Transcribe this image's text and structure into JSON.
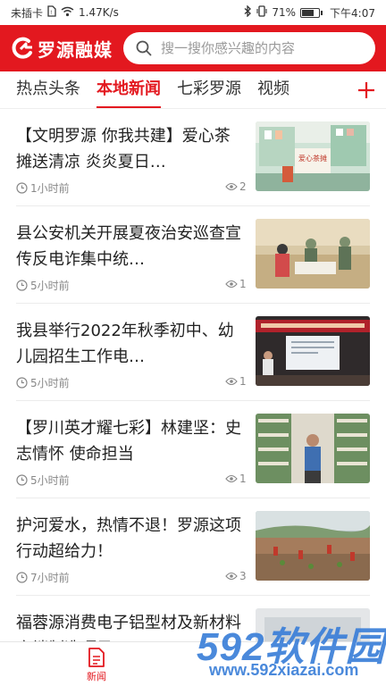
{
  "status_bar": {
    "sim_status": "未插卡",
    "speed": "1.47K/s",
    "battery_level": "71%",
    "battery_fraction": 0.71,
    "time": "下午4:07"
  },
  "header": {
    "logo_text": "罗源融媒",
    "search_placeholder": "搜一搜你感兴趣的内容",
    "brand_color": "#e3181f"
  },
  "tabs": [
    {
      "label": "热点头条",
      "active": false
    },
    {
      "label": "本地新闻",
      "active": true
    },
    {
      "label": "七彩罗源",
      "active": false
    },
    {
      "label": "视频",
      "active": false
    }
  ],
  "add_tab_icon": "plus-icon",
  "news": [
    {
      "title": "【文明罗源 你我共建】爱心茶摊送清凉 炎炎夏日…",
      "time": "1小时前",
      "views": "2",
      "thumb": "pharmacy-counter-photo"
    },
    {
      "title": "县公安机关开展夏夜治安巡查宣传反电诈集中统…",
      "time": "5小时前",
      "views": "1",
      "thumb": "police-patrol-photo"
    },
    {
      "title": "我县举行2022年秋季初中、幼儿园招生工作电…",
      "time": "5小时前",
      "views": "1",
      "thumb": "meeting-room-photo"
    },
    {
      "title": "【罗川英才耀七彩】林建坚：史志情怀 使命担当",
      "time": "5小时前",
      "views": "1",
      "thumb": "archive-shelves-photo"
    },
    {
      "title": "护河爱水，热情不退！罗源这项行动超给力！",
      "time": "7小时前",
      "views": "3",
      "thumb": "riverbank-volunteers-photo"
    },
    {
      "title": "福蓉源消费电子铝型材及新材料高端制造项目…",
      "time": "",
      "views": "",
      "thumb": "building-photo"
    }
  ],
  "bottom_nav": {
    "items": [
      {
        "label": "新闻",
        "icon": "document-icon",
        "active": true
      }
    ]
  },
  "watermark": {
    "text": "592软件园",
    "url": "www.592xiazai.com"
  }
}
